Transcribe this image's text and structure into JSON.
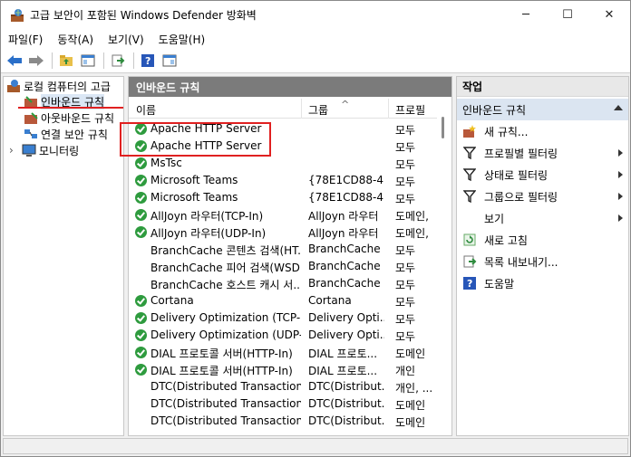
{
  "window": {
    "title": "고급 보안이 포함된 Windows Defender 방화벽",
    "minimize_glyph": "─",
    "maximize_glyph": "☐",
    "close_glyph": "✕"
  },
  "menu": [
    "파일(F)",
    "동작(A)",
    "보기(V)",
    "도움말(H)"
  ],
  "tree": {
    "root": "로컬 컴퓨터의 고급",
    "items": [
      "인바운드 규칙",
      "아웃바운드 규칙",
      "연결 보안 규칙",
      "모니터링"
    ],
    "expand_glyph": "›"
  },
  "center": {
    "header": "인바운드 규칙",
    "columns": {
      "name": "이름",
      "group": "그룹",
      "profile": "프로필"
    },
    "sort_glyph": "^",
    "rows": [
      {
        "name": "Apache HTTP Server",
        "group": "",
        "profile": "모두",
        "enabled": true
      },
      {
        "name": "Apache HTTP Server",
        "group": "",
        "profile": "모두",
        "enabled": true
      },
      {
        "name": "MsTsc",
        "group": "",
        "profile": "모두",
        "enabled": true
      },
      {
        "name": "Microsoft Teams",
        "group": "{78E1CD88-4...",
        "profile": "모두",
        "enabled": true
      },
      {
        "name": "Microsoft Teams",
        "group": "{78E1CD88-4...",
        "profile": "모두",
        "enabled": true
      },
      {
        "name": "AllJoyn 라우터(TCP-In)",
        "group": "AllJoyn 라우터",
        "profile": "도메인,",
        "enabled": true
      },
      {
        "name": "AllJoyn 라우터(UDP-In)",
        "group": "AllJoyn 라우터",
        "profile": "도메인,",
        "enabled": true
      },
      {
        "name": "BranchCache 콘텐츠 검색(HT...",
        "group": "BranchCache ...",
        "profile": "모두",
        "enabled": false
      },
      {
        "name": "BranchCache 피어 검색(WSD...",
        "group": "BranchCache ...",
        "profile": "모두",
        "enabled": false
      },
      {
        "name": "BranchCache 호스트 캐시 서...",
        "group": "BranchCache ...",
        "profile": "모두",
        "enabled": false
      },
      {
        "name": "Cortana",
        "group": "Cortana",
        "profile": "모두",
        "enabled": true
      },
      {
        "name": "Delivery Optimization (TCP-In)",
        "group": "Delivery Opti...",
        "profile": "모두",
        "enabled": true
      },
      {
        "name": "Delivery Optimization (UDP-I...",
        "group": "Delivery Opti...",
        "profile": "모두",
        "enabled": true
      },
      {
        "name": "DIAL 프로토콜 서버(HTTP-In)",
        "group": "DIAL 프로토...",
        "profile": "도메인",
        "enabled": true
      },
      {
        "name": "DIAL 프로토콜 서버(HTTP-In)",
        "group": "DIAL 프로토...",
        "profile": "개인",
        "enabled": true
      },
      {
        "name": "DTC(Distributed Transaction ...",
        "group": "DTC(Distribut...",
        "profile": "개인, ...",
        "enabled": false
      },
      {
        "name": "DTC(Distributed Transaction ...",
        "group": "DTC(Distribut...",
        "profile": "도메인",
        "enabled": false
      },
      {
        "name": "DTC(Distributed Transaction ...",
        "group": "DTC(Distribut...",
        "profile": "도메인",
        "enabled": false
      }
    ]
  },
  "actions": {
    "header": "작업",
    "section": "인바운드 규칙",
    "items": [
      {
        "label": "새 규칙...",
        "icon": "new-rule-icon",
        "submenu": false
      },
      {
        "label": "프로필별 필터링",
        "icon": "filter-icon",
        "submenu": true
      },
      {
        "label": "상태로 필터링",
        "icon": "filter-icon",
        "submenu": true
      },
      {
        "label": "그룹으로 필터링",
        "icon": "filter-icon",
        "submenu": true
      },
      {
        "label": "보기",
        "icon": "",
        "submenu": true
      },
      {
        "label": "새로 고침",
        "icon": "refresh-icon",
        "submenu": false
      },
      {
        "label": "목록 내보내기...",
        "icon": "export-icon",
        "submenu": false
      },
      {
        "label": "도움말",
        "icon": "help-icon",
        "submenu": false
      }
    ]
  },
  "colors": {
    "enabled_check": "#2e9b3e",
    "highlight_red": "#e02020",
    "header_gray": "#7b7b7b",
    "section_blue": "#dbe5f1"
  }
}
